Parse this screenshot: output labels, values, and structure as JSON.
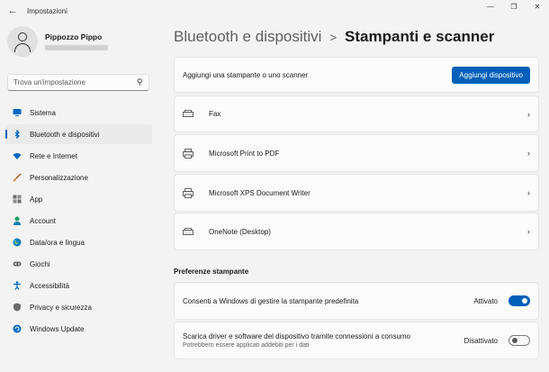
{
  "window": {
    "title": "Impostazioni"
  },
  "profile": {
    "name": "Pippozzo Pippo"
  },
  "search": {
    "placeholder": "Trova un'impostazione"
  },
  "nav": {
    "items": [
      {
        "label": "Sistema",
        "icon": "monitor-icon",
        "color": "#0067c0"
      },
      {
        "label": "Bluetooth e dispositivi",
        "icon": "bluetooth-icon",
        "color": "#0067c0",
        "active": true
      },
      {
        "label": "Rete e Internet",
        "icon": "wifi-icon",
        "color": "#0067c0"
      },
      {
        "label": "Personalizzazione",
        "icon": "brush-icon",
        "color": "#e3872d"
      },
      {
        "label": "App",
        "icon": "apps-icon",
        "color": "#6b6b6b"
      },
      {
        "label": "Account",
        "icon": "account-icon",
        "color": "#1a9e6a"
      },
      {
        "label": "Data/ora e lingua",
        "icon": "globe-clock-icon",
        "color": "#0f7fb5"
      },
      {
        "label": "Giochi",
        "icon": "gamepad-icon",
        "color": "#6b6b6b"
      },
      {
        "label": "Accessibilità",
        "icon": "accessibility-icon",
        "color": "#0067c0"
      },
      {
        "label": "Privacy e sicurezza",
        "icon": "shield-icon",
        "color": "#6b6b6b"
      },
      {
        "label": "Windows Update",
        "icon": "update-icon",
        "color": "#0067c0"
      }
    ]
  },
  "breadcrumb": {
    "parent": "Bluetooth e dispositivi",
    "separator": ">",
    "current": "Stampanti e scanner"
  },
  "add_printer": {
    "label": "Aggiungi una stampante o uno scanner",
    "button": "Aggiungi dispositivo"
  },
  "printers": [
    {
      "name": "Fax"
    },
    {
      "name": "Microsoft Print to PDF"
    },
    {
      "name": "Microsoft XPS Document Writer"
    },
    {
      "name": "OneNote (Desktop)"
    }
  ],
  "preferences": {
    "title": "Preferenze stampante",
    "default_printer": {
      "label": "Consenti a Windows di gestire la stampante predefinita",
      "state": "Attivato",
      "on": true
    },
    "metered": {
      "label": "Scarica driver e software del dispositivo tramite connessioni a consumo",
      "sub": "Potrebbero essere applicati addebiti per i dati",
      "state": "Disattivato",
      "on": false
    }
  },
  "colors": {
    "accent": "#005fb8"
  }
}
